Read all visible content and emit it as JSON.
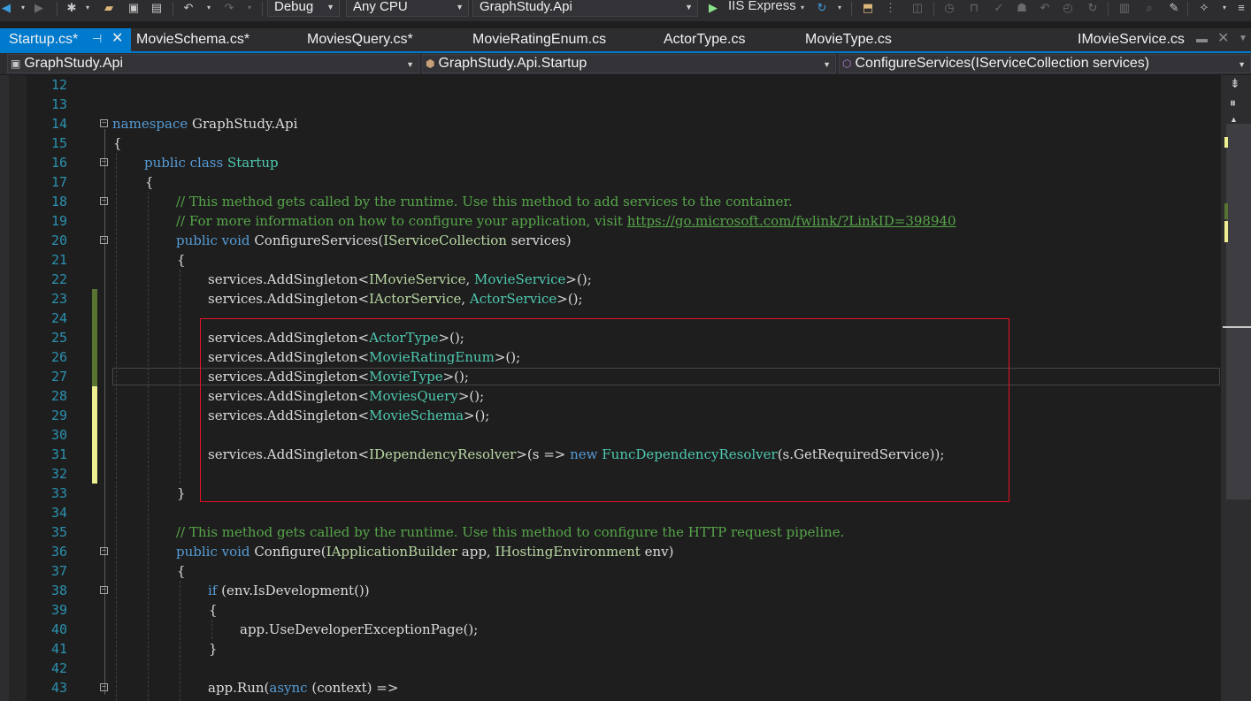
{
  "toolbar": {
    "config": "Debug",
    "platform": "Any CPU",
    "startup_project": "GraphStudy.Api",
    "run_target": "IIS Express"
  },
  "tabs": [
    {
      "label": "Startup.cs*",
      "active": true
    },
    {
      "label": "MovieSchema.cs*"
    },
    {
      "label": "MoviesQuery.cs*"
    },
    {
      "label": "MovieRatingEnum.cs"
    },
    {
      "label": "ActorType.cs"
    },
    {
      "label": "MovieType.cs"
    },
    {
      "label": "IMovieService.cs"
    }
  ],
  "navbar": {
    "project": "GraphStudy.Api",
    "type": "GraphStudy.Api.Startup",
    "member": "ConfigureServices(IServiceCollection services)"
  },
  "line_numbers": [
    "12",
    "13",
    "14",
    "15",
    "16",
    "17",
    "18",
    "19",
    "20",
    "21",
    "22",
    "23",
    "24",
    "25",
    "26",
    "27",
    "28",
    "29",
    "30",
    "31",
    "32",
    "33",
    "34",
    "35",
    "36",
    "37",
    "38",
    "39",
    "40",
    "41",
    "42",
    "43"
  ],
  "code": {
    "l14": {
      "kw": "namespace",
      "rest": " GraphStudy.Api"
    },
    "l15": "{",
    "l16": {
      "kw": "public class",
      "type": "Startup"
    },
    "l17": "{",
    "l18": "// This method gets called by the runtime. Use this method to add services to the container.",
    "l19": {
      "comment": "// For more information on how to configure your application, visit ",
      "link": "https://go.microsoft.com/fwlink/?LinkID=398940"
    },
    "l20": {
      "kw": "public void",
      "name": " ConfigureServices(",
      "iface": "IServiceCollection",
      "rest": " services)"
    },
    "l21": "{",
    "l22": {
      "pre": "services.AddSingleton<",
      "iface": "IMovieService",
      "mid": ", ",
      "type": "MovieService",
      "post": ">();"
    },
    "l23": {
      "pre": "services.AddSingleton<",
      "iface": "IActorService",
      "mid": ", ",
      "type": "ActorService",
      "post": ">();"
    },
    "l25": {
      "pre": "services.AddSingleton<",
      "type": "ActorType",
      "post": ">();"
    },
    "l26": {
      "pre": "services.AddSingleton<",
      "type": "MovieRatingEnum",
      "post": ">();"
    },
    "l27": {
      "pre": "services.AddSingleton<",
      "type": "MovieType",
      "post": ">();"
    },
    "l28": {
      "pre": "services.AddSingleton<",
      "type": "MoviesQuery",
      "post": ">();"
    },
    "l29": {
      "pre": "services.AddSingleton<",
      "type": "MovieSchema",
      "post": ">();"
    },
    "l31": {
      "pre": "services.AddSingleton<",
      "iface": "IDependencyResolver",
      "mid": ">(s => ",
      "kw": "new",
      "type": " FuncDependencyResolver",
      "post": "(s.GetRequiredService));"
    },
    "l33": "}",
    "l35": "// This method gets called by the runtime. Use this method to configure the HTTP request pipeline.",
    "l36": {
      "kw": "public void",
      "name": " Configure(",
      "iface": "IApplicationBuilder",
      "mid": " app, ",
      "iface2": "IHostingEnvironment",
      "rest": " env)"
    },
    "l37": "{",
    "l38": {
      "kw": "if",
      "rest": " (env.IsDevelopment())"
    },
    "l39": "{",
    "l40": "app.UseDeveloperExceptionPage();",
    "l41": "}",
    "l43": {
      "pre": "app.Run(",
      "kw": "async",
      "rest": " (context) =>"
    }
  },
  "colors": {
    "keyword": "#569cd6",
    "type": "#4ec9b0",
    "interface": "#b8d7a3",
    "comment": "#57a64a",
    "line_number": "#2b91af",
    "highlight_box": "#e81123",
    "saved_change": "#577430",
    "unsaved_change": "#efef91"
  }
}
